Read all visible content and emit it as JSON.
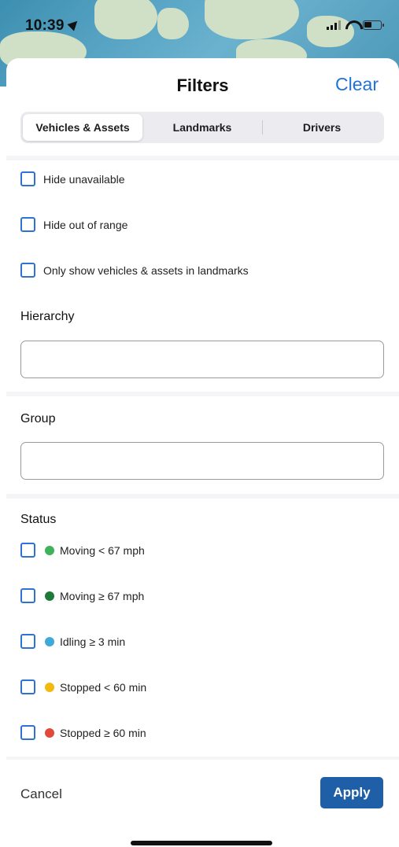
{
  "status_bar": {
    "time": "10:39"
  },
  "sheet": {
    "title": "Filters",
    "clear_label": "Clear",
    "tabs": [
      {
        "label": "Vehicles & Assets",
        "active": true
      },
      {
        "label": "Landmarks",
        "active": false
      },
      {
        "label": "Drivers",
        "active": false
      }
    ],
    "options": [
      {
        "label": "Hide unavailable",
        "checked": false
      },
      {
        "label": "Hide out of range",
        "checked": false
      },
      {
        "label": "Only show vehicles & assets in landmarks",
        "checked": false
      }
    ],
    "hierarchy": {
      "label": "Hierarchy",
      "value": ""
    },
    "group": {
      "label": "Group",
      "value": ""
    },
    "status": {
      "label": "Status",
      "items": [
        {
          "label": "Moving < 67 mph",
          "color": "#3fb35a",
          "checked": false
        },
        {
          "label": "Moving ≥ 67 mph",
          "color": "#1f7a3a",
          "checked": false
        },
        {
          "label": "Idling ≥ 3 min",
          "color": "#3fa9d9",
          "checked": false
        },
        {
          "label": "Stopped < 60 min",
          "color": "#f2b90f",
          "checked": false
        },
        {
          "label": "Stopped ≥ 60 min",
          "color": "#e2493b",
          "checked": false
        }
      ]
    },
    "footer": {
      "cancel_label": "Cancel",
      "apply_label": "Apply"
    }
  }
}
